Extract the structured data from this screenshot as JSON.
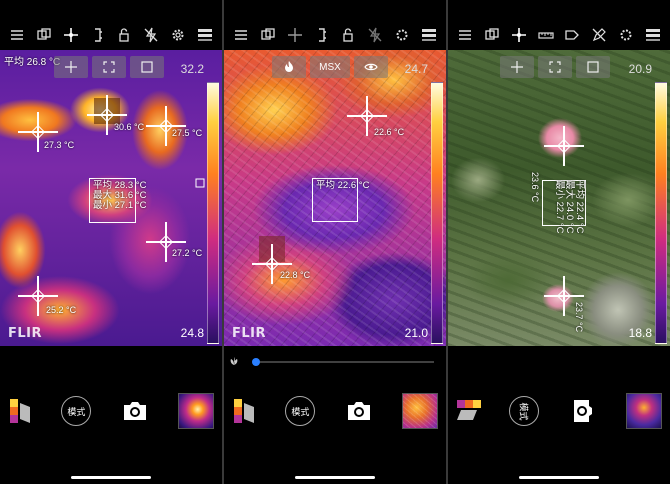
{
  "panels": [
    {
      "id": "p1",
      "topbar_icons": [
        "menu-icon",
        "copy-icon",
        "crosshair-icon",
        "bracket-icon",
        "lock-icon",
        "no-flash-icon",
        "settings-gear-icon",
        "layers-icon"
      ],
      "average_label": "平均 26.8 °C",
      "quickbar": [
        "spot-tool-icon",
        "area-tool-icon",
        "frame-tool-icon"
      ],
      "scale_top": "32.2",
      "scale_bottom": "24.8",
      "spots": [
        {
          "label": "27.3 °C"
        },
        {
          "label": "30.6 °C"
        },
        {
          "label": "27.5 °C"
        },
        {
          "label": "27.2 °C"
        },
        {
          "label": "25.2 °C"
        }
      ],
      "area_lines": [
        "平均 28.3 °C",
        "最大 31.6 °C",
        "最小 27.1 °C"
      ],
      "logo": "FLIR",
      "mode_label": "模式"
    },
    {
      "id": "p2",
      "topbar_icons": [
        "menu-icon",
        "copy-icon",
        "crosshair-icon",
        "bracket-icon",
        "lock-icon",
        "no-flash-icon",
        "settings-gear-icon",
        "layers-icon"
      ],
      "quickbar": [
        "flame-icon",
        "MSX",
        "eye-icon"
      ],
      "quickbar_text": "MSX",
      "scale_top": "24.7",
      "scale_bottom": "21.0",
      "spots": [
        {
          "label": "22.6 °C"
        },
        {
          "label": "22.8 °C"
        }
      ],
      "area_lines": [
        "平均 22.6 °C"
      ],
      "logo": "FLIR",
      "mode_label": "模式"
    },
    {
      "id": "p3",
      "topbar_icons": [
        "menu-icon",
        "copy-icon",
        "crosshair-icon",
        "ruler-icon",
        "tag-icon",
        "no-edit-icon",
        "settings-gear-icon",
        "layers-icon"
      ],
      "quickbar": [
        "spot-tool-icon",
        "area-tool-icon",
        "frame-tool-icon"
      ],
      "scale_top": "20.9",
      "scale_bottom": "18.8",
      "spots": [
        {
          "label": "23.6 °C"
        },
        {
          "label": "23.7 °C"
        }
      ],
      "area_lines": [
        "平均 22.4 °C",
        "最大 24.0 °C",
        "最小 22.7 °C"
      ],
      "mode_label": "模式"
    }
  ],
  "colors": {
    "ironbow_dark": "#3a1a8a",
    "ironbow_mid": "#c02090",
    "ironbow_hot": "#ffb020",
    "ironbow_white": "#fff2a0",
    "slider_accent": "#2a7fff"
  }
}
